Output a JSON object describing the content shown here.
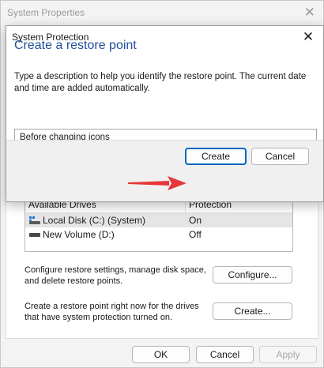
{
  "background_window": {
    "title": "System Properties",
    "drives": {
      "header": {
        "col1": "Available Drives",
        "col2": "Protection"
      },
      "rows": [
        {
          "name": "Local Disk (C:) (System)",
          "protection": "On"
        },
        {
          "name": "New Volume (D:)",
          "protection": "Off"
        }
      ]
    },
    "configure_text": "Configure restore settings, manage disk space, and delete restore points.",
    "configure_label": "Configure...",
    "create_text": "Create a restore point right now for the drives that have system protection turned on.",
    "create_label": "Create...",
    "ok_label": "OK",
    "cancel_label": "Cancel",
    "apply_label": "Apply"
  },
  "dialog": {
    "title": "System Protection",
    "heading": "Create a restore point",
    "description": "Type a description to help you identify the restore point. The current date and time are added automatically.",
    "input_value": "Before changing icons",
    "create_label": "Create",
    "cancel_label": "Cancel"
  },
  "colors": {
    "heading": "#1f4e9c",
    "accent": "#0067c0",
    "arrow": "#e8363a"
  },
  "icons": {
    "close": "close-icon",
    "system_drive": "system-drive-icon",
    "drive": "drive-icon",
    "pointer": "red-arrow-icon"
  }
}
